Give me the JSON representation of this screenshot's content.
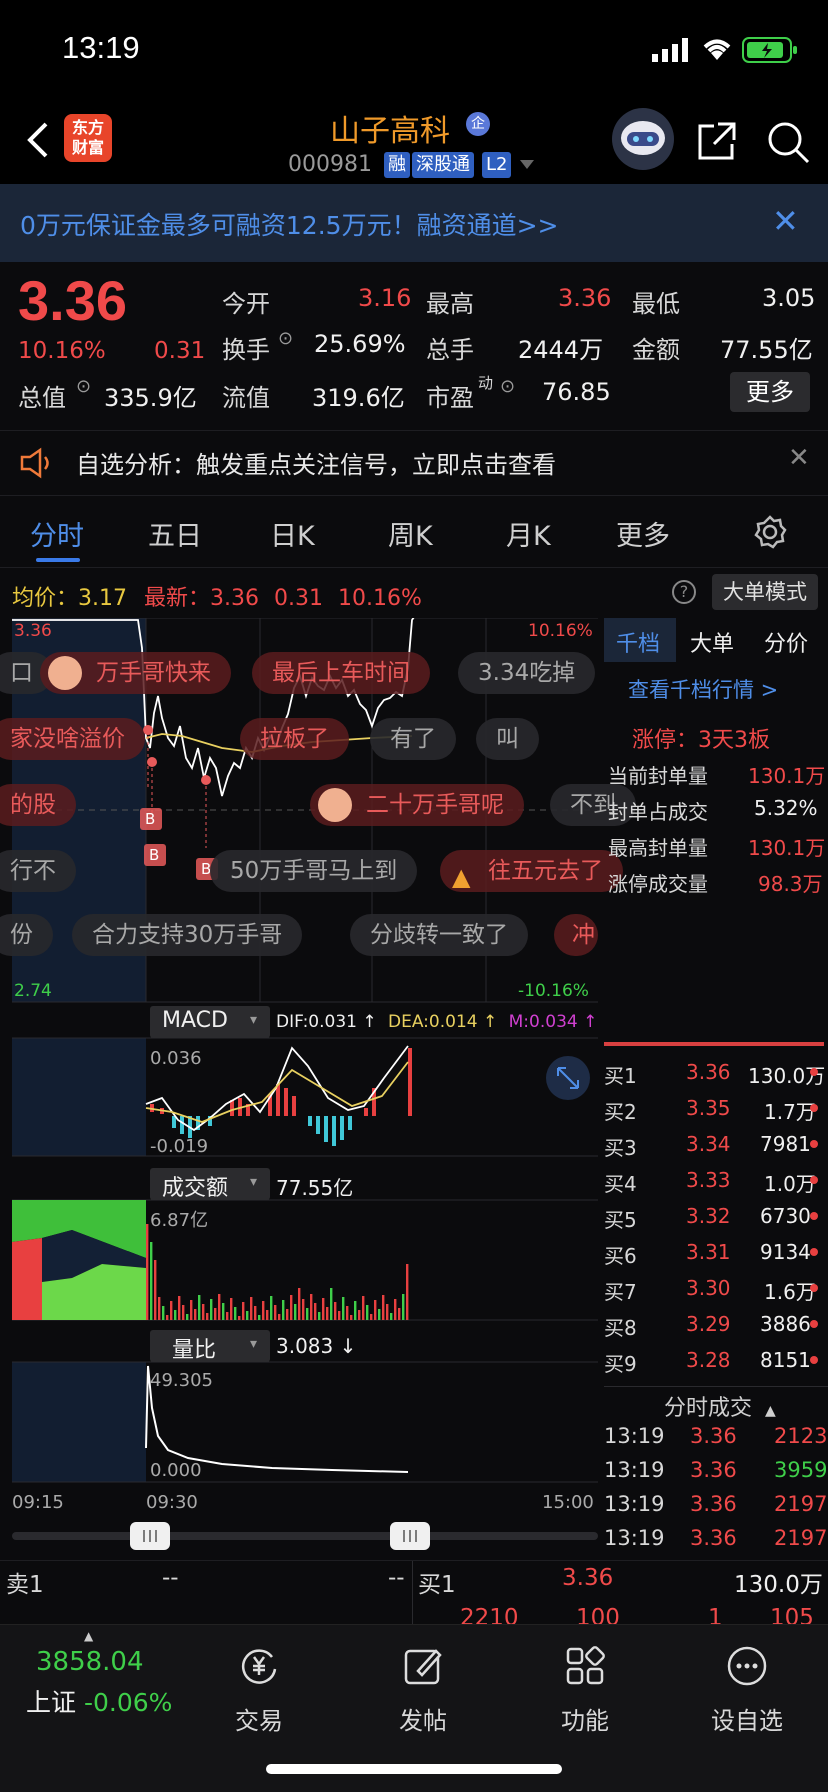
{
  "status_bar": {
    "time": "13:19"
  },
  "header": {
    "logo_line1": "东方",
    "logo_line2": "财富",
    "stock_name": "山子高科",
    "ent_badge": "企",
    "stock_code": "000981",
    "tags": [
      "融",
      "深股通",
      "L2"
    ]
  },
  "banner": {
    "text": "0万元保证金最多可融资12.5万元！融资通道>>"
  },
  "quote": {
    "price": "3.36",
    "change_pct": "10.16%",
    "change": "0.31",
    "total_value_label": "总值",
    "total_value": "335.9亿",
    "fields": [
      {
        "label": "今开",
        "value": "3.16"
      },
      {
        "label": "最高",
        "value": "3.36"
      },
      {
        "label": "最低",
        "value": "3.05"
      },
      {
        "label": "换手",
        "value": "25.69%"
      },
      {
        "label": "总手",
        "value": "2444万"
      },
      {
        "label": "金额",
        "value": "77.55亿"
      },
      {
        "label": "流值",
        "value": "319.6亿"
      },
      {
        "label": "市盈",
        "value": "76.85"
      }
    ],
    "pe_superscript": "动",
    "more": "更多"
  },
  "notice": {
    "text": "自选分析：触发重点关注信号，立即点击查看"
  },
  "tabs": [
    "分时",
    "五日",
    "日K",
    "周K",
    "月K",
    "更多"
  ],
  "chart_header": {
    "avg_label": "均价：",
    "avg_value": "3.17",
    "latest_label": "最新：",
    "latest_value": "3.36",
    "latest_change": "0.31",
    "latest_pct": "10.16%",
    "bigorder": "大单模式"
  },
  "chart_labels": {
    "top_left": "3.36",
    "top_right": "10.16%",
    "bottom_left": "2.74",
    "bottom_right": "-10.16%",
    "macd_name": "MACD",
    "dif": "DIF:0.031 ↑",
    "dea": "DEA:0.014 ↑",
    "m": "M:0.034 ↑",
    "macd_top": "0.036",
    "macd_bottom": "-0.019",
    "vol_name": "成交额",
    "vol_total": "77.55亿",
    "vol_top": "6.87亿",
    "ratio_name": "量比",
    "ratio_value": "3.083 ↓",
    "ratio_top": "49.305",
    "ratio_bottom": "0.000",
    "time_start": "09:15",
    "time_mid": "09:30",
    "time_end": "15:00",
    "markers": [
      "B",
      "B",
      "B"
    ]
  },
  "bubbles": [
    {
      "text": "口",
      "style": "g"
    },
    {
      "text": "万手哥快来",
      "style": "r"
    },
    {
      "text": "最后上车时间",
      "style": "r"
    },
    {
      "text": "3.34吃掉",
      "style": "g"
    },
    {
      "text": "家没啥溢价",
      "style": "r"
    },
    {
      "text": "拉板了",
      "style": "r"
    },
    {
      "text": "有了",
      "style": "g"
    },
    {
      "text": "叫",
      "style": "g"
    },
    {
      "text": "的股",
      "style": "r"
    },
    {
      "text": "二十万手哥呢",
      "style": "r"
    },
    {
      "text": "不到",
      "style": "g"
    },
    {
      "text": "行不",
      "style": "g"
    },
    {
      "text": "50万手哥马上到",
      "style": "g"
    },
    {
      "text": "往五元去了",
      "style": "r"
    },
    {
      "text": "份",
      "style": "g"
    },
    {
      "text": "合力支持30万手哥",
      "style": "g"
    },
    {
      "text": "分歧转一致了",
      "style": "g"
    },
    {
      "text": "冲",
      "style": "r"
    }
  ],
  "right_panel": {
    "tabs": [
      "千档",
      "大单",
      "分价"
    ],
    "link": "查看千档行情 >",
    "limit_up": "涨停：3天3板",
    "stats": [
      {
        "label": "当前封单量",
        "value": "130.1万"
      },
      {
        "label": "封单占成交",
        "value": "5.32%"
      },
      {
        "label": "最高封单量",
        "value": "130.1万"
      },
      {
        "label": "涨停成交量",
        "value": "98.3万"
      }
    ],
    "bids": [
      {
        "label": "买1",
        "price": "3.36",
        "vol": "130.0万"
      },
      {
        "label": "买2",
        "price": "3.35",
        "vol": "1.7万"
      },
      {
        "label": "买3",
        "price": "3.34",
        "vol": "7981"
      },
      {
        "label": "买4",
        "price": "3.33",
        "vol": "1.0万"
      },
      {
        "label": "买5",
        "price": "3.32",
        "vol": "6730"
      },
      {
        "label": "买6",
        "price": "3.31",
        "vol": "9134"
      },
      {
        "label": "买7",
        "price": "3.30",
        "vol": "1.6万"
      },
      {
        "label": "买8",
        "price": "3.29",
        "vol": "3886"
      },
      {
        "label": "买9",
        "price": "3.28",
        "vol": "8151"
      }
    ],
    "trades_title": "分时成交",
    "trades": [
      {
        "time": "13:19",
        "price": "3.36",
        "vol": "2123",
        "color": "red"
      },
      {
        "time": "13:19",
        "price": "3.36",
        "vol": "3959",
        "color": "green"
      },
      {
        "time": "13:19",
        "price": "3.36",
        "vol": "2197",
        "color": "red"
      },
      {
        "time": "13:19",
        "price": "3.36",
        "vol": "2197",
        "color": "red"
      }
    ]
  },
  "book_row": {
    "sell_label": "卖1",
    "sell_price": "--",
    "sell_vol": "--",
    "buy_label": "买1",
    "buy_price": "3.36",
    "buy_vol": "130.0万",
    "partial": [
      "2210",
      "100",
      "1",
      "105"
    ]
  },
  "bottom_nav": {
    "index_value": "3858.04",
    "index_name": "上证",
    "index_change": "-0.06%",
    "items": [
      "交易",
      "发帖",
      "功能",
      "设自选"
    ]
  }
}
